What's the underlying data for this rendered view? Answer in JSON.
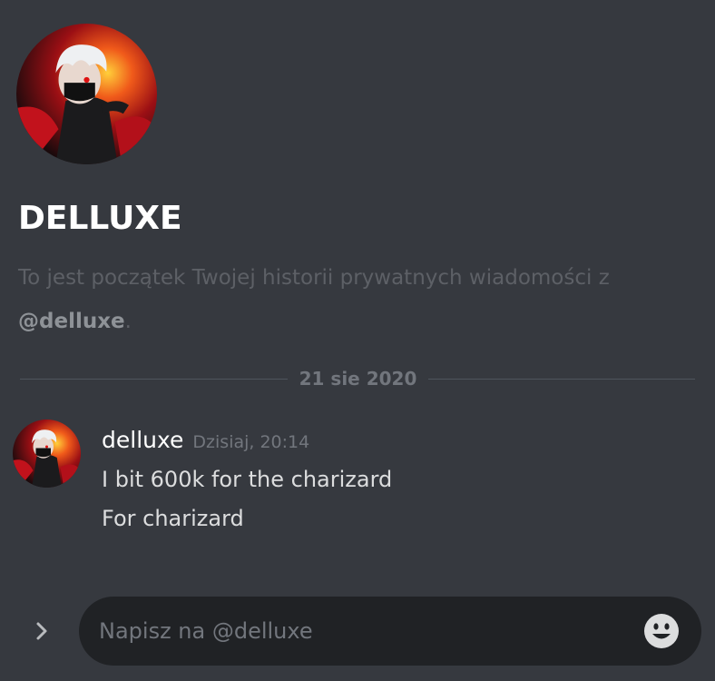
{
  "dm": {
    "title": "DELLUXE",
    "intro_text": "To jest początek Twojej historii prywatnych wiadomości z ",
    "intro_mention": "@delluxe",
    "intro_end": "."
  },
  "divider": {
    "date": "21 sie 2020"
  },
  "message": {
    "author": "delluxe",
    "timestamp": "Dzisiaj, 20:14",
    "lines": [
      "I bit 600k for the charizard",
      "For charizard"
    ]
  },
  "composer": {
    "placeholder": "Napisz na @delluxe",
    "value": ""
  },
  "icons": {
    "expand": "chevron-right-icon",
    "emoji": "smiley-face-icon"
  },
  "colors": {
    "background": "#36393f",
    "composer": "#202225",
    "title": "#ffffff",
    "muted": "#72767d"
  }
}
